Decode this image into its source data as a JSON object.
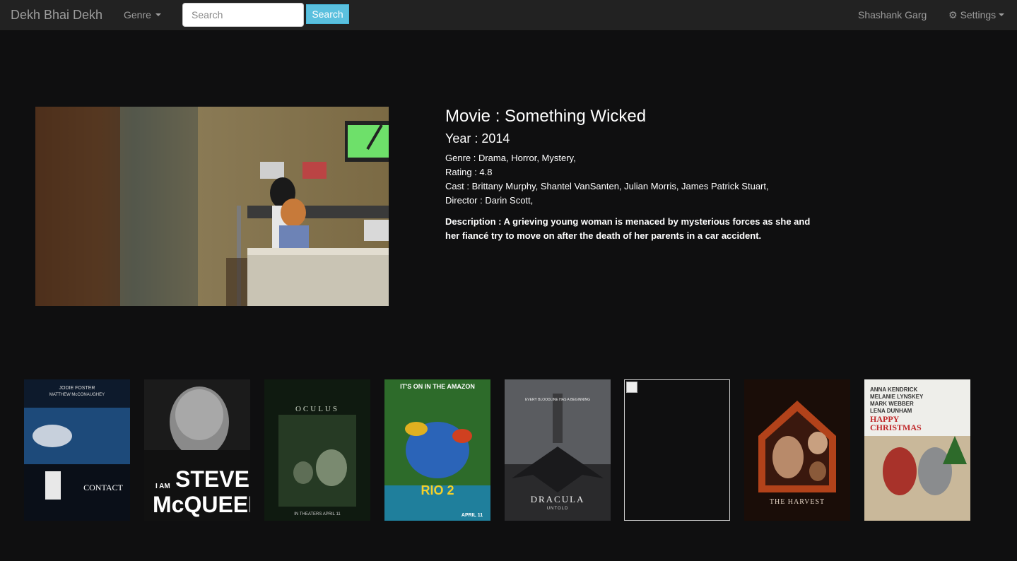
{
  "navbar": {
    "brand": "Dekh Bhai Dekh",
    "genre_label": "Genre",
    "search_placeholder": "Search",
    "search_button": "Search",
    "user_name": "Shashank Garg",
    "settings_label": "Settings"
  },
  "movie": {
    "title": "Movie : Something Wicked",
    "year": "Year : 2014",
    "genre": "Genre : Drama, Horror, Mystery,",
    "rating": "Rating : 4.8",
    "cast": "Cast : Brittany Murphy, Shantel VanSanten, Julian Morris, James Patrick Stuart,",
    "director": "Director : Darin Scott,",
    "description": "Description : A grieving young woman is menaced by mysterious forces as she and her fiancé try to move on after the death of her parents in a car accident."
  },
  "posters": [
    {
      "name": "Contact",
      "line1": "JODIE FOSTER",
      "line2": "MATTHEW McCONAUGHEY",
      "title": "CONTACT"
    },
    {
      "name": "I Am Steve McQueen",
      "line1": "I AM",
      "line2": "STEVE",
      "title": "McQUEEN"
    },
    {
      "name": "Oculus",
      "title": "OCULUS",
      "footer": "IN THEATERS APRIL 11"
    },
    {
      "name": "Rio 2",
      "line1": "IT'S ON IN THE AMAZON",
      "title": "RIO 2",
      "footer": "APRIL 11"
    },
    {
      "name": "Dracula Untold",
      "line1": "EVERY BLOODLINE HAS A BEGINNING",
      "title": "DRACULA",
      "line2": "UNTOLD"
    },
    {
      "name": "Broken poster"
    },
    {
      "name": "The Harvest",
      "title": "THE HARVEST"
    },
    {
      "name": "Happy Christmas",
      "line1": "ANNA KENDRICK",
      "line2": "MELANIE LYNSKEY",
      "line3": "MARK WEBBER",
      "line4": "LENA DUNHAM",
      "title": "HAPPY",
      "title2": "CHRISTMAS"
    }
  ],
  "colors": {
    "navbar": "#222222",
    "background": "#0f0f10",
    "search_button": "#5bc0de"
  }
}
